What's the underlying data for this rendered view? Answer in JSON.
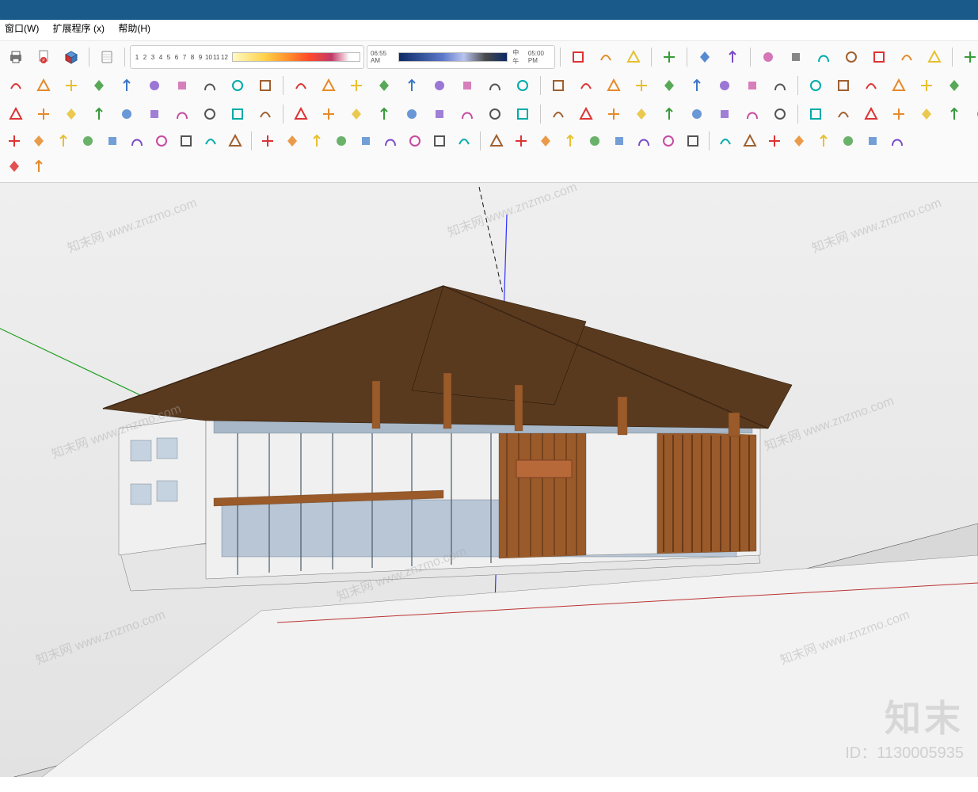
{
  "menu": {
    "window": "窗口(W)",
    "ext": "扩展程序 (x)",
    "help": "帮助(H)"
  },
  "shadow": {
    "nums": [
      "1",
      "2",
      "3",
      "4",
      "5",
      "6",
      "7",
      "8",
      "9",
      "10",
      "11",
      "12"
    ],
    "t1": "06:55 AM",
    "tm": "中午",
    "t2": "05:00 PM"
  },
  "wm": {
    "brand": "知末",
    "id": "ID：1130005935",
    "repeat": "知末网 www.znzmo.com"
  },
  "icons": {
    "row1": [
      "print-icon",
      "pdf-icon",
      "pack-icon",
      "notebook-icon",
      "box-white-icon",
      "matchphoto-icon",
      "nav-icon",
      "iso-icon",
      "view-top-icon",
      "view-front-icon",
      "view-back-icon",
      "view-left-icon",
      "view-right-icon",
      "shade-xray-icon",
      "shade-active-icon",
      "hidden-line-icon",
      "house-new-icon",
      "warehouse-icon",
      "house-icon",
      "building-icon",
      "house-flat-icon",
      "toolbox-icon",
      "diamond-icon",
      "sky1-icon",
      "sky2-icon"
    ],
    "row2": [
      "stairs-icon",
      "bars-icon",
      "road-join-icon",
      "road-cross-icon",
      "road-curve-icon",
      "road-ramp-icon",
      "road-ramp2-icon",
      "road-arc-icon",
      "poly1-icon",
      "undo-arc-icon",
      "road-profile-icon",
      "dbl-line-icon",
      "section-icon",
      "brush-icon",
      "cylinder-icon",
      "poly-edit-icon",
      "cube-icon",
      "wave-icon",
      "curve-icon",
      "dot-icon",
      "dots-icon",
      "lines-icon",
      "swirl-icon",
      "spray-icon",
      "bar-set-icon",
      "arc-over-icon",
      "lane-icon",
      "divider-icon",
      "flip-h-icon",
      "mirror-icon",
      "comp-icon",
      "search-icon",
      "broom-icon",
      "calc-icon",
      "calendar-icon",
      "badge-icon",
      "tool-a-icon",
      "tool-b-icon",
      "tool-c-icon",
      "tool-d-icon",
      "tool-e-icon",
      "tool-f-icon",
      "tool-g-icon"
    ],
    "row3": [
      "arc-red-icon",
      "rect-orange-icon",
      "spiral-orange-icon",
      "arc2-red-icon",
      "rect2-orange-icon",
      "rect3-orange-icon",
      "circle1-icon",
      "circle2-icon",
      "circle-dbl-icon",
      "circle3-icon",
      "diamond-y-icon",
      "wrench-green-icon",
      "ellipse-y-icon",
      "hex-y-icon",
      "lumion-icon",
      "play-icon",
      "screen-icon",
      "screen2-icon",
      "screen-rec-icon",
      "screen-cam-icon",
      "sun-icon",
      "cube-y-icon",
      "cube-o-icon",
      "cube-r-icon",
      "up-blue-icon",
      "up-red-j-icon",
      "up-green-r-icon",
      "up-yellow-n-icon",
      "up-orange-s-icon",
      "up-red-f-icon",
      "up-yel2-icon",
      "up-org2-icon",
      "up-red2-icon",
      "up-blue2-icon",
      "up-mag-icon",
      "sel-box-icon",
      "rect-mag-icon",
      "cyl-grey-icon"
    ],
    "row4": [
      "shell1-icon",
      "shell2-icon",
      "shell3-icon",
      "shell4-icon",
      "grid-y-icon",
      "flag-fr-icon",
      "doc-icon",
      "doc2-icon",
      "eraser-icon",
      "o-cyan1-icon",
      "o-cyan2-icon",
      "o-cyan3-icon",
      "o-cyan4-icon",
      "o-cyan5-icon",
      "rhombus-y-icon",
      "o-cyan6-icon",
      "o-cyan7-icon",
      "sun-y-icon",
      "poly-blue-icon",
      "poly-blue2-icon",
      "arrow-r-icon",
      "angle-icon",
      "blob1-icon",
      "blob2-icon",
      "blob3-icon",
      "sphere-icon",
      "bool1-icon",
      "bool2-icon",
      "bool3-icon",
      "bool4-icon",
      "bool5-icon",
      "bool6-icon",
      "light-icon",
      "q-blue-icon",
      "arc-tool-icon",
      "cross-icon"
    ],
    "row5": [
      "undo-icon",
      "doc-new-icon"
    ]
  }
}
